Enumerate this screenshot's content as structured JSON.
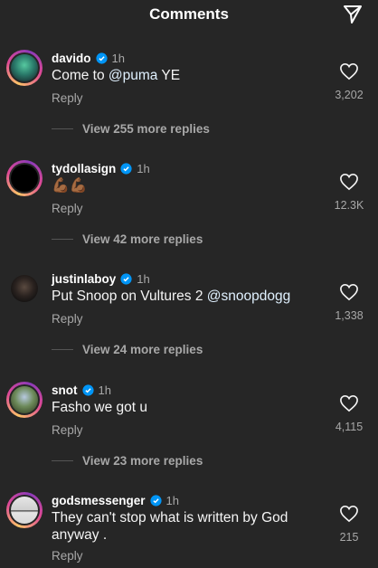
{
  "header": {
    "title": "Comments"
  },
  "comments": [
    {
      "username": "davido",
      "time": "1h",
      "text_plain": "Come to ",
      "mention": "@puma",
      "text_after": " YE",
      "reply_label": "Reply",
      "likes": "3,202",
      "view_replies": "View 255 more replies"
    },
    {
      "username": "tydollasign",
      "time": "1h",
      "text_emoji": "💪🏾💪🏾",
      "reply_label": "Reply",
      "likes": "12.3K",
      "view_replies": "View 42 more replies"
    },
    {
      "username": "justinlaboy",
      "time": "1h",
      "text_plain": "Put Snoop on Vultures 2 ",
      "mention": "@snoopdogg",
      "reply_label": "Reply",
      "likes": "1,338",
      "view_replies": "View 24 more replies"
    },
    {
      "username": "snot",
      "time": "1h",
      "text_plain": "Fasho we got u",
      "reply_label": "Reply",
      "likes": "4,115",
      "view_replies": "View 23 more replies"
    },
    {
      "username": "godsmessenger",
      "time": "1h",
      "text_plain": "They can't stop what is written by God anyway .",
      "reply_label": "Reply",
      "likes": "215"
    }
  ],
  "colors": {
    "background": "#262626",
    "verified": "#0095f6",
    "mention": "#e0f1ff",
    "secondary_text": "#a8a8a8"
  },
  "icons": {
    "header": "send-icon",
    "verified": "verified-badge-icon",
    "like": "heart-outline-icon"
  }
}
